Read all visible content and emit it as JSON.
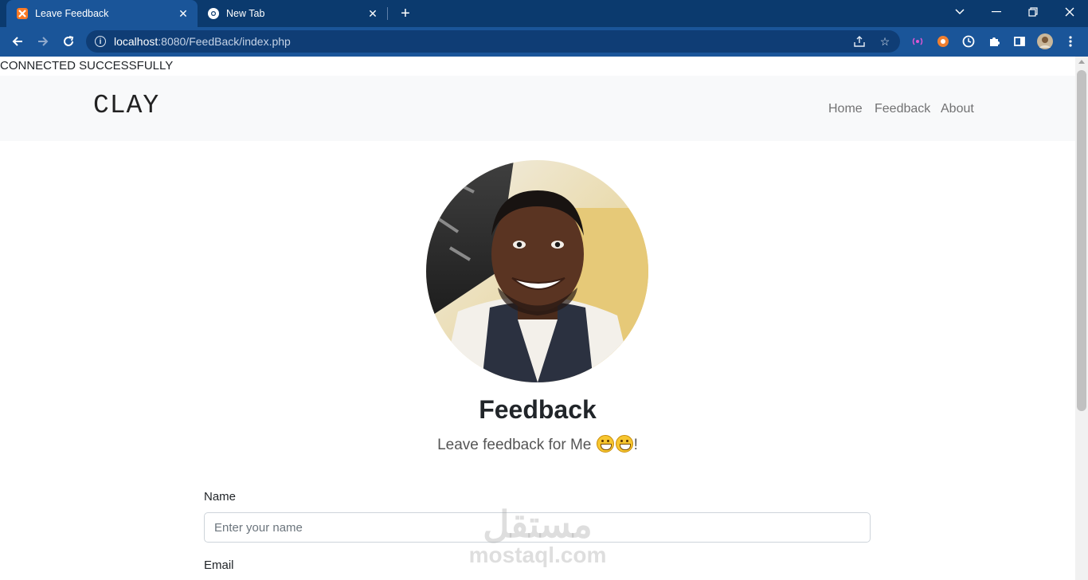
{
  "browser": {
    "tabs": [
      {
        "title": "Leave Feedback",
        "active": true
      },
      {
        "title": "New Tab",
        "active": false
      }
    ],
    "address": {
      "host": "localhost",
      "rest": ":8080/FeedBack/index.php"
    }
  },
  "page": {
    "status_text": "CONNECTED SUCCESSFULLY",
    "brand": "CLAY",
    "nav": [
      {
        "label": "Home"
      },
      {
        "label": "Feedback"
      },
      {
        "label": "About"
      }
    ],
    "heading": "Feedback",
    "lead_text": "Leave feedback for Me",
    "lead_suffix": "!",
    "form": {
      "name_label": "Name",
      "name_placeholder": "Enter your name",
      "email_label": "Email"
    },
    "watermark": {
      "arabic": "مستقل",
      "latin": "mostaql.com"
    }
  }
}
